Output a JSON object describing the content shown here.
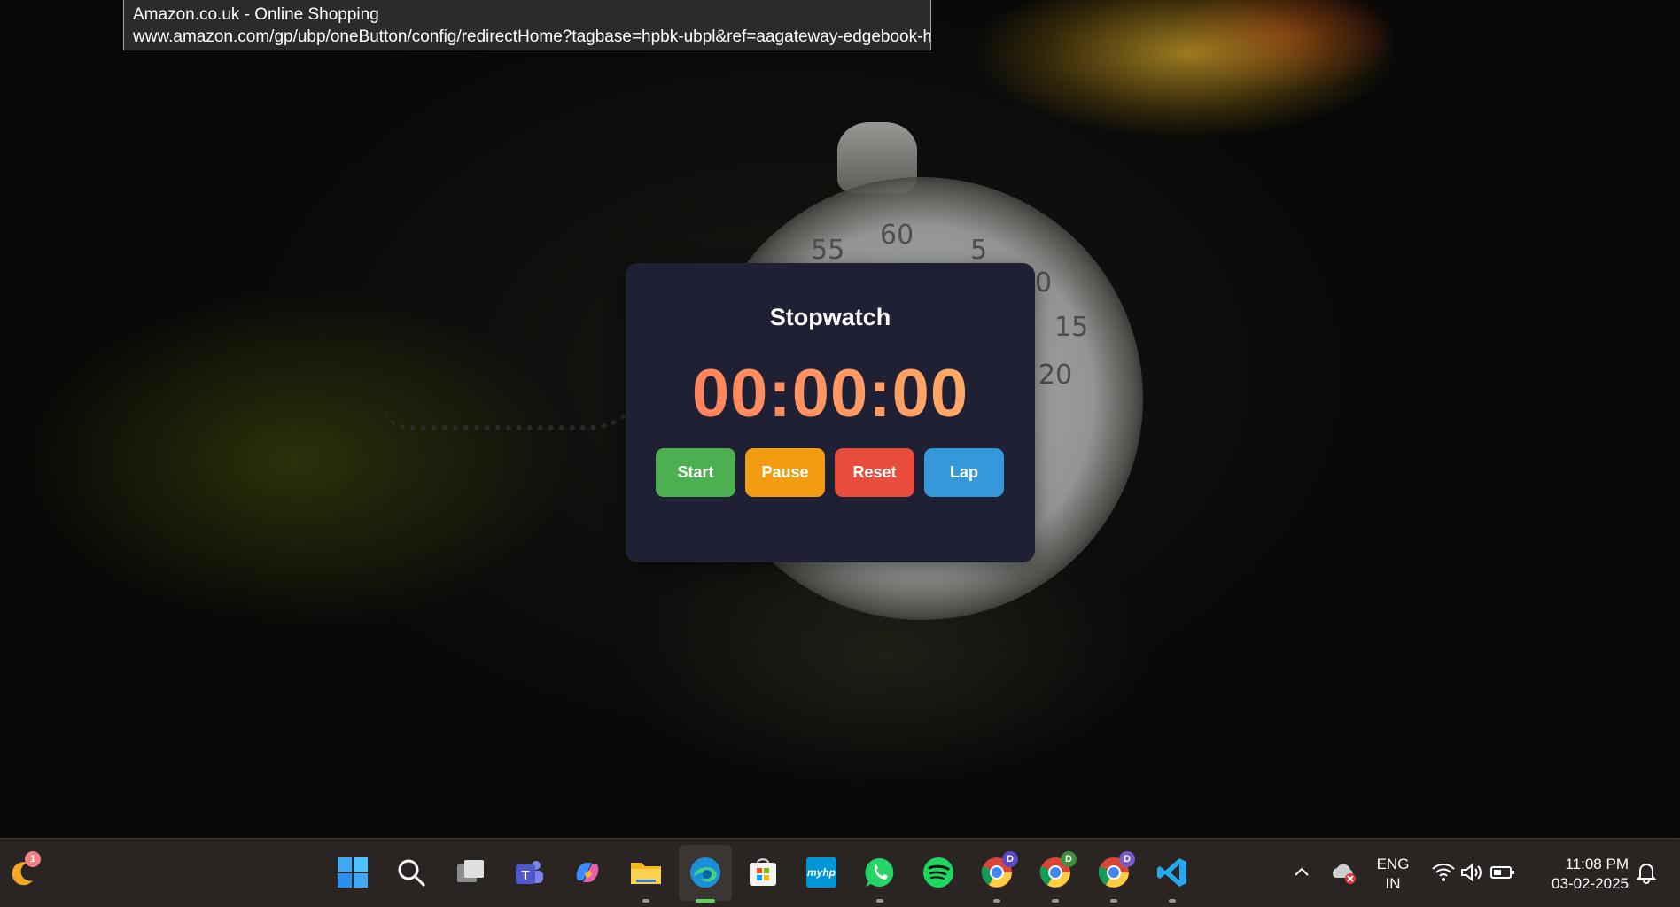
{
  "tooltip": {
    "title": "Amazon.co.uk - Online Shopping",
    "url": "www.amazon.com/gp/ubp/oneButton/config/redirectHome?tagbase=hpbk-ubpl&ref=aagateway-edgebook-hp"
  },
  "wallpaper": {
    "dial_numbers": [
      "55",
      "60",
      "5",
      "0",
      "15",
      "20"
    ]
  },
  "stopwatch": {
    "title": "Stopwatch",
    "time": "00:00:00",
    "buttons": {
      "start": "Start",
      "pause": "Pause",
      "reset": "Reset",
      "lap": "Lap"
    },
    "colors": {
      "card": "#1f2033",
      "start": "#4caf50",
      "pause": "#f39c12",
      "reset": "#e74c3c",
      "lap": "#3498db",
      "time_gradient": [
        "#ff7a5a",
        "#ffb36b"
      ]
    }
  },
  "taskbar": {
    "widgets_badge": "1",
    "apps": [
      {
        "name": "Start",
        "icon": "windows-icon"
      },
      {
        "name": "Search",
        "icon": "search-icon"
      },
      {
        "name": "Task View",
        "icon": "task-view-icon"
      },
      {
        "name": "Teams",
        "icon": "teams-icon"
      },
      {
        "name": "Copilot",
        "icon": "copilot-icon"
      },
      {
        "name": "File Explorer",
        "icon": "file-explorer-icon"
      },
      {
        "name": "Microsoft Edge",
        "icon": "edge-icon"
      },
      {
        "name": "Microsoft Store",
        "icon": "store-icon"
      },
      {
        "name": "myHP",
        "icon": "myhp-icon",
        "label": "myhp"
      },
      {
        "name": "WhatsApp",
        "icon": "whatsapp-icon"
      },
      {
        "name": "Spotify",
        "icon": "spotify-icon"
      },
      {
        "name": "Chrome",
        "icon": "chrome-icon",
        "badge": "D"
      },
      {
        "name": "Chrome",
        "icon": "chrome-icon",
        "badge": "D"
      },
      {
        "name": "Chrome",
        "icon": "chrome-icon",
        "badge": "D"
      },
      {
        "name": "Visual Studio Code",
        "icon": "vscode-icon"
      }
    ],
    "tray": {
      "language_line1": "ENG",
      "language_line2": "IN",
      "time": "11:08 PM",
      "date": "03-02-2025"
    }
  }
}
